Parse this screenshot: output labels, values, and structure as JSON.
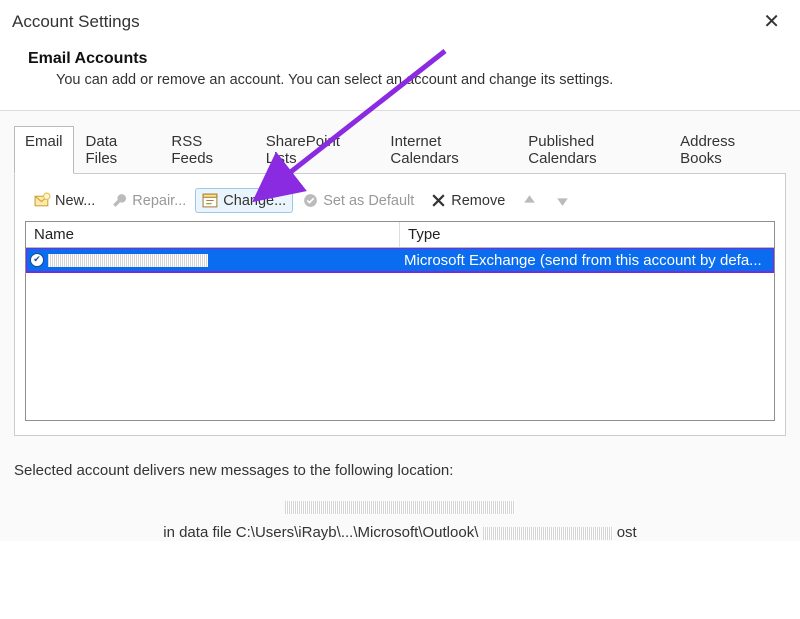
{
  "window": {
    "title": "Account Settings"
  },
  "header": {
    "title": "Email Accounts",
    "description": "You can add or remove an account. You can select an account and change its settings."
  },
  "tabs": [
    {
      "label": "Email",
      "active": true
    },
    {
      "label": "Data Files"
    },
    {
      "label": "RSS Feeds"
    },
    {
      "label": "SharePoint Lists"
    },
    {
      "label": "Internet Calendars"
    },
    {
      "label": "Published Calendars"
    },
    {
      "label": "Address Books"
    }
  ],
  "toolbar": {
    "new": "New...",
    "repair": "Repair...",
    "change": "Change...",
    "set_default": "Set as Default",
    "remove": "Remove"
  },
  "columns": {
    "name": "Name",
    "type": "Type"
  },
  "row": {
    "type": "Microsoft Exchange (send from this account by defa..."
  },
  "footer": {
    "line1": "Selected account delivers new messages to the following location:",
    "line3_prefix": "in data file C:\\Users\\iRayb\\...\\Microsoft\\Outlook\\",
    "line3_suffix": "ost"
  },
  "annotation": {
    "arrow_color": "#8a2be2"
  }
}
